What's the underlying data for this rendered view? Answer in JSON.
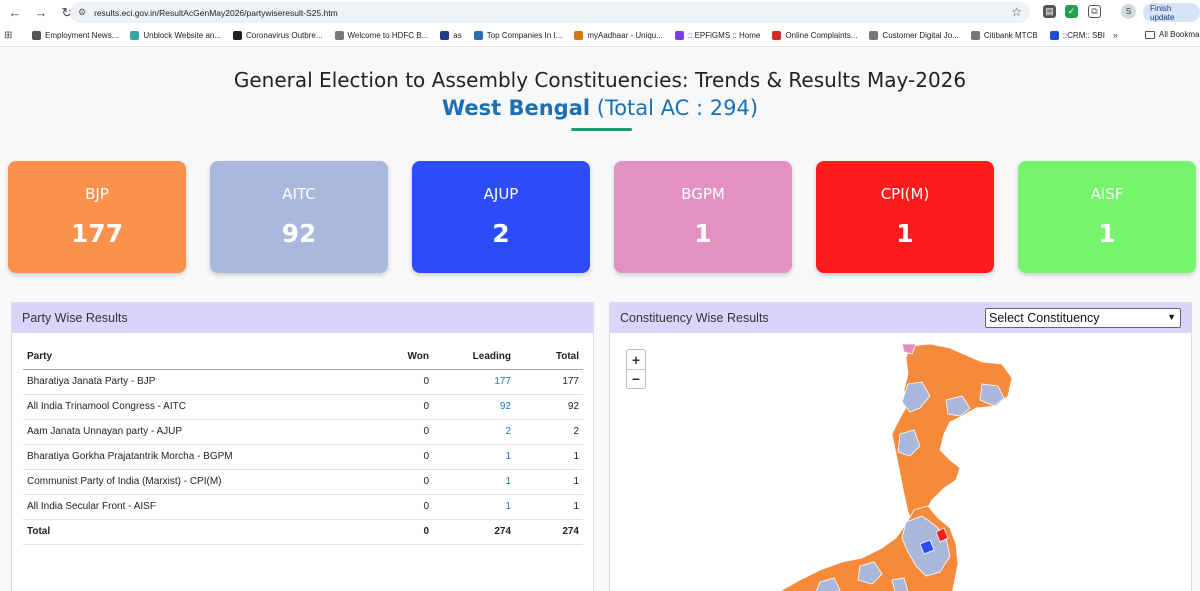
{
  "browser": {
    "url": "results.eci.gov.in/ResultAcGenMay2026/partywiseresult-S25.htm",
    "profile_initial": "S",
    "finish_update_label": "Finish update",
    "bookmarks": [
      {
        "label": "Employment News...",
        "color": "#555555"
      },
      {
        "label": "Unblock Website an...",
        "color": "#3aa6a0"
      },
      {
        "label": "Coronavirus Outbre...",
        "color": "#222222"
      },
      {
        "label": "Welcome to HDFC B...",
        "color": "#777777"
      },
      {
        "label": "as",
        "color": "#1e3a8a"
      },
      {
        "label": "Top Companies In I...",
        "color": "#2b6cb0"
      },
      {
        "label": "myAadhaar - Uniqu...",
        "color": "#d97706"
      },
      {
        "label": ":: EPFiGMS :: Home",
        "color": "#7c3aed"
      },
      {
        "label": "Online Complaints...",
        "color": "#dc2626"
      },
      {
        "label": "Customer Digital Jo...",
        "color": "#777777"
      },
      {
        "label": "Citibank MTCB",
        "color": "#777777"
      },
      {
        "label": "::CRM:: SBI",
        "color": "#1d4ed8"
      }
    ],
    "more_label": "»",
    "all_bookmarks_label": "All Bookmarks"
  },
  "header": {
    "title": "General Election to Assembly Constituencies: Trends & Results May-2026",
    "state": "West Bengal",
    "total_ac": "(Total AC : 294)"
  },
  "cards": [
    {
      "party": "BJP",
      "count": "177",
      "color": "#fb914a"
    },
    {
      "party": "AITC",
      "count": "92",
      "color": "#aab8dc"
    },
    {
      "party": "AJUP",
      "count": "2",
      "color": "#2b4cf7"
    },
    {
      "party": "BGPM",
      "count": "1",
      "color": "#e391c2"
    },
    {
      "party": "CPI(M)",
      "count": "1",
      "color": "#fd1c1c"
    },
    {
      "party": "AISF",
      "count": "1",
      "color": "#75f56b"
    }
  ],
  "party_panel": {
    "title": "Party Wise Results",
    "columns": [
      "Party",
      "Won",
      "Leading",
      "Total"
    ],
    "rows": [
      {
        "party": "Bharatiya Janata Party - BJP",
        "won": "0",
        "leading": "177",
        "total": "177"
      },
      {
        "party": "All India Trinamool Congress - AITC",
        "won": "0",
        "leading": "92",
        "total": "92"
      },
      {
        "party": "Aam Janata Unnayan party - AJUP",
        "won": "0",
        "leading": "2",
        "total": "2"
      },
      {
        "party": "Bharatiya Gorkha Prajatantrik Morcha - BGPM",
        "won": "0",
        "leading": "1",
        "total": "1"
      },
      {
        "party": "Communist Party of India (Marxist) - CPI(M)",
        "won": "0",
        "leading": "1",
        "total": "1"
      },
      {
        "party": "All India Secular Front - AISF",
        "won": "0",
        "leading": "1",
        "total": "1"
      }
    ],
    "total_row": {
      "label": "Total",
      "won": "0",
      "leading": "274",
      "total": "274"
    }
  },
  "constituency_panel": {
    "title": "Constituency Wise Results",
    "select_value": "Select Constituency",
    "zoom_in": "+",
    "zoom_out": "−"
  }
}
